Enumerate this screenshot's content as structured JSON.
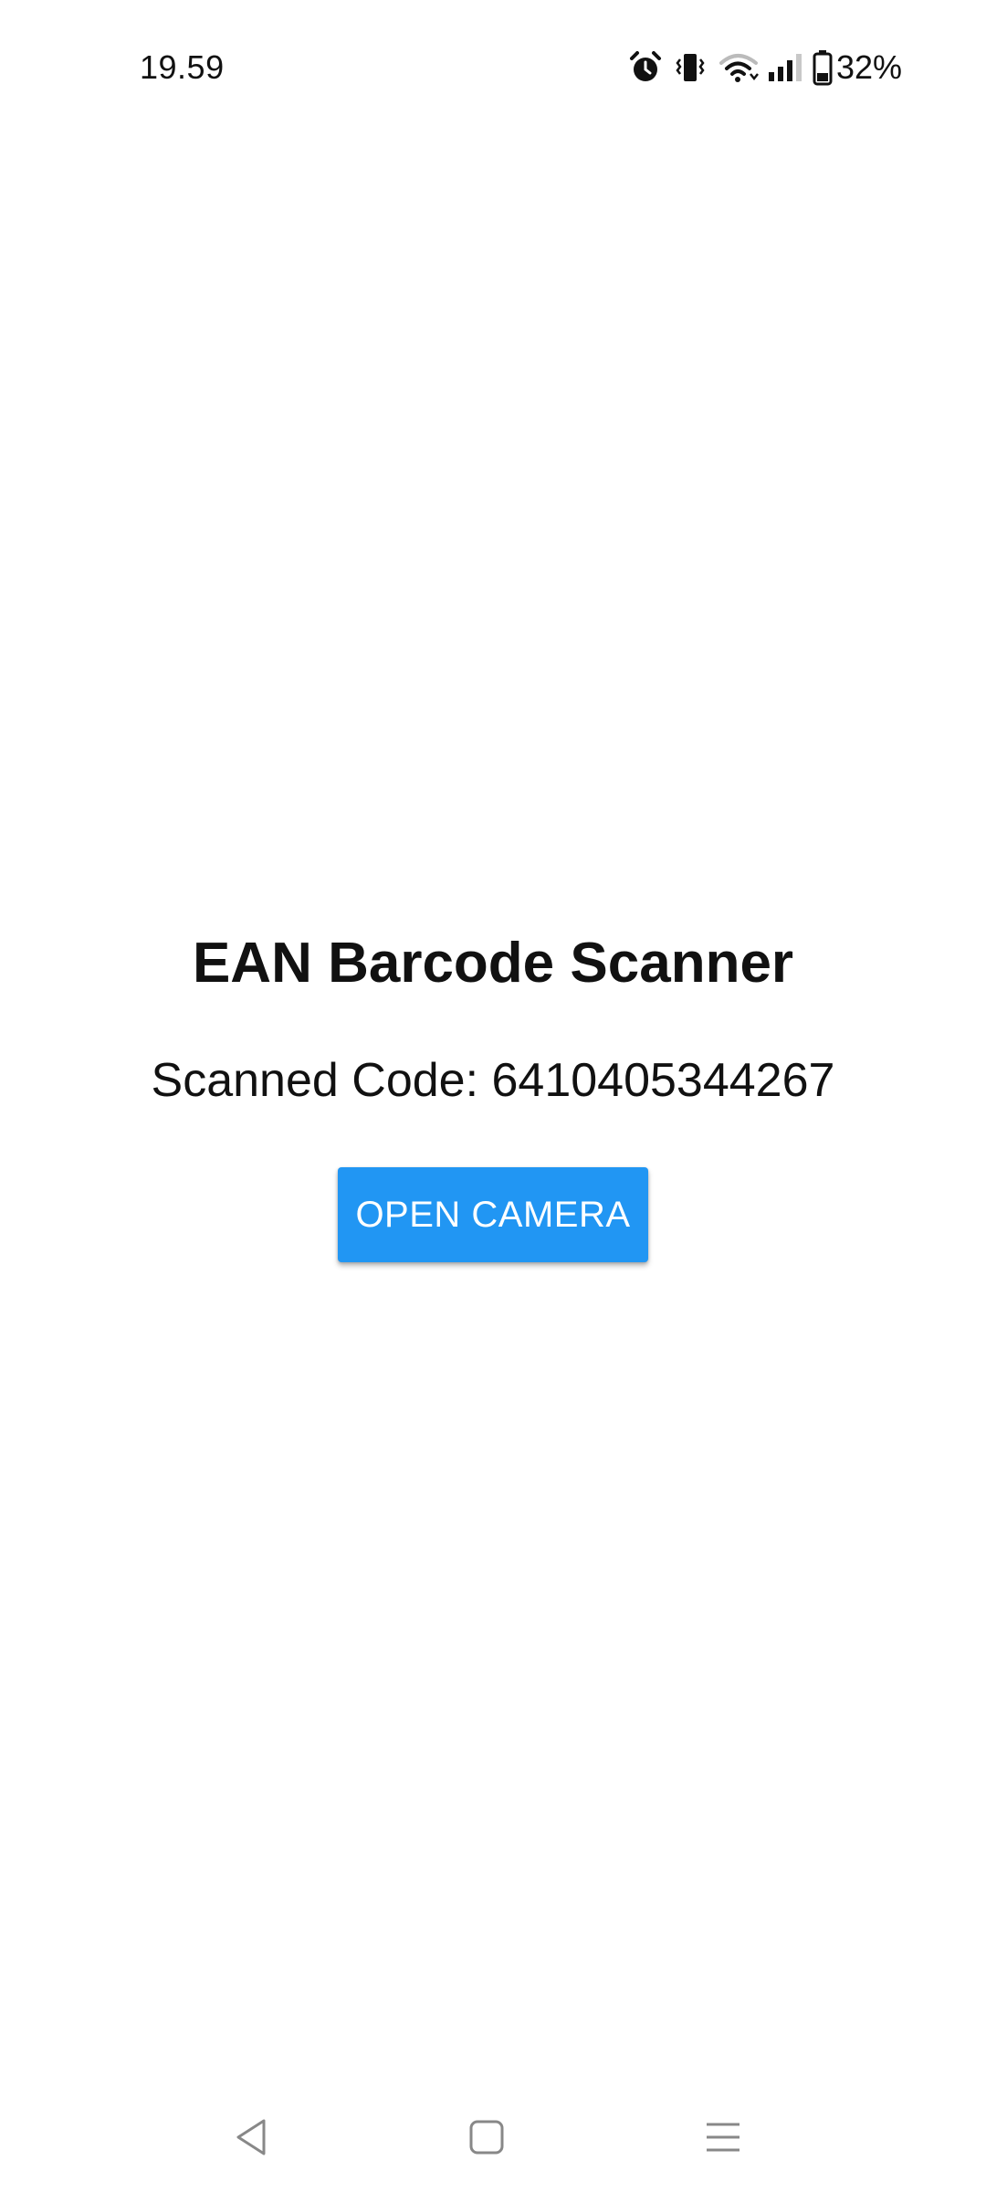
{
  "status_bar": {
    "time": "19.59",
    "icons": [
      "alarm-icon",
      "vibrate-icon",
      "wifi-icon",
      "signal-icon",
      "battery-icon"
    ],
    "battery_percent": "32%"
  },
  "main": {
    "title": "EAN Barcode Scanner",
    "scanned_label": "Scanned Code:",
    "scanned_value": "6410405344267",
    "open_camera_label": "OPEN CAMERA"
  },
  "nav_bar": {
    "items": [
      "back-icon",
      "home-icon",
      "recents-icon"
    ]
  },
  "colors": {
    "accent": "#2196F3",
    "background": "#FFFFFF",
    "text": "#111111"
  }
}
